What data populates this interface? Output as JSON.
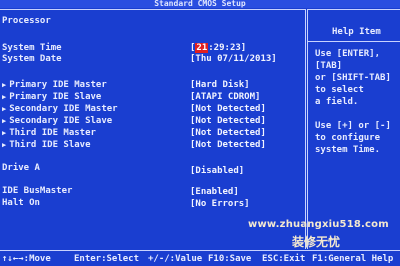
{
  "header": {
    "title": "Standard CMOS Setup"
  },
  "section": {
    "title": "Processor"
  },
  "rows": [
    {
      "label": "System Time",
      "arrow": false,
      "value_pre": "[",
      "value_hl": "21",
      "value_post": ":29:23]"
    },
    {
      "label": "System Date",
      "arrow": false,
      "value": "[Thu 07/11/2013]"
    },
    {
      "label": "Primary IDE Master",
      "arrow": true,
      "value": "[Hard Disk]"
    },
    {
      "label": "Primary IDE Slave",
      "arrow": true,
      "value": "[ATAPI CDROM]"
    },
    {
      "label": "Secondary IDE Master",
      "arrow": true,
      "value": "[Not Detected]"
    },
    {
      "label": "Secondary IDE Slave",
      "arrow": true,
      "value": "[Not Detected]"
    },
    {
      "label": "Third IDE Master",
      "arrow": true,
      "value": "[Not Detected]"
    },
    {
      "label": "Third IDE Slave",
      "arrow": true,
      "value": "[Not Detected]"
    },
    {
      "label": "Drive A",
      "arrow": false,
      "value": "[Disabled]"
    },
    {
      "label": "IDE BusMaster",
      "arrow": false,
      "value": "[Enabled]"
    },
    {
      "label": "Halt On",
      "arrow": false,
      "value": "[No Errors]"
    }
  ],
  "help": {
    "title": "Help Item",
    "lines": [
      "Use [ENTER],",
      "[TAB]",
      "or [SHIFT-TAB]",
      "to select",
      "a field.",
      "Use [+] or [-]",
      "to configure",
      "system Time."
    ]
  },
  "watermark": {
    "url": "www.zhuangxiu518.com",
    "cn": "装修无忧"
  },
  "footer": [
    "↑↓←→:Move",
    "Enter:Select",
    "+/-/:Value",
    "F10:Save",
    "ESC:Exit",
    "F1:General Help"
  ],
  "colors": {
    "background": "#1a3ed0",
    "highlight": "#e02020",
    "text": "#e8ecff"
  }
}
